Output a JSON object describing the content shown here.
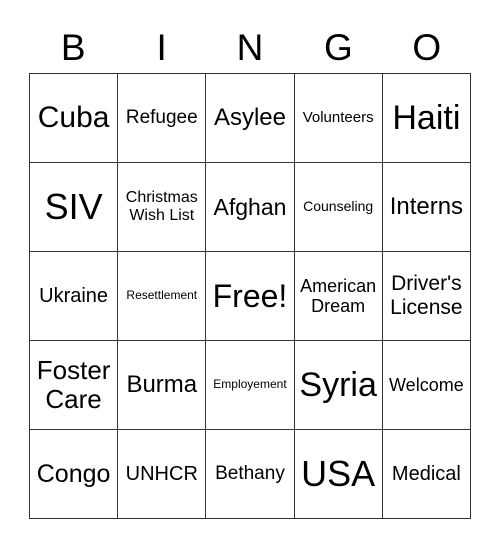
{
  "header": [
    "B",
    "I",
    "N",
    "G",
    "O"
  ],
  "grid": [
    [
      "Cuba",
      "Refugee",
      "Asylee",
      "Volunteers",
      "Haiti"
    ],
    [
      "SIV",
      "Christmas Wish List",
      "Afghan",
      "Counseling",
      "Interns"
    ],
    [
      "Ukraine",
      "Resettlement",
      "Free!",
      "American Dream",
      "Driver's License"
    ],
    [
      "Foster Care",
      "Burma",
      "Employement",
      "Syria",
      "Welcome"
    ],
    [
      "Congo",
      "UNHCR",
      "Bethany",
      "USA",
      "Medical"
    ]
  ]
}
